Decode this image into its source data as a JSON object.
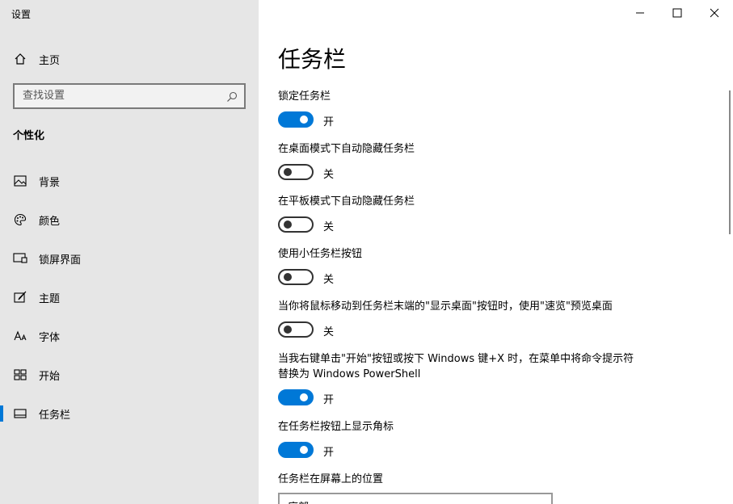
{
  "app_title": "设置",
  "window_controls": {
    "minimize": "minimize-icon",
    "maximize": "maximize-icon",
    "close": "close-icon"
  },
  "sidebar": {
    "home_label": "主页",
    "search_placeholder": "查找设置",
    "section_title": "个性化",
    "items": [
      {
        "label": "背景",
        "icon": "picture-icon"
      },
      {
        "label": "颜色",
        "icon": "palette-icon"
      },
      {
        "label": "锁屏界面",
        "icon": "lock-screen-icon"
      },
      {
        "label": "主题",
        "icon": "theme-brush-icon"
      },
      {
        "label": "字体",
        "icon": "font-icon"
      },
      {
        "label": "开始",
        "icon": "start-grid-icon"
      },
      {
        "label": "任务栏",
        "icon": "taskbar-icon",
        "active": true
      }
    ]
  },
  "main": {
    "title": "任务栏",
    "settings": [
      {
        "label": "锁定任务栏",
        "on": true,
        "state": "开"
      },
      {
        "label": "在桌面模式下自动隐藏任务栏",
        "on": false,
        "state": "关"
      },
      {
        "label": "在平板模式下自动隐藏任务栏",
        "on": false,
        "state": "关"
      },
      {
        "label": "使用小任务栏按钮",
        "on": false,
        "state": "关"
      },
      {
        "label": "当你将鼠标移动到任务栏末端的\"显示桌面\"按钮时，使用\"速览\"预览桌面",
        "on": false,
        "state": "关"
      },
      {
        "label": "当我右键单击\"开始\"按钮或按下 Windows 键+X 时，在菜单中将命令提示符替换为 Windows PowerShell",
        "on": true,
        "state": "开"
      },
      {
        "label": "在任务栏按钮上显示角标",
        "on": true,
        "state": "开"
      }
    ],
    "position_label": "任务栏在屏幕上的位置",
    "position_value": "底部"
  },
  "colors": {
    "accent": "#0078d7",
    "sidebar_bg": "#e6e6e6"
  }
}
